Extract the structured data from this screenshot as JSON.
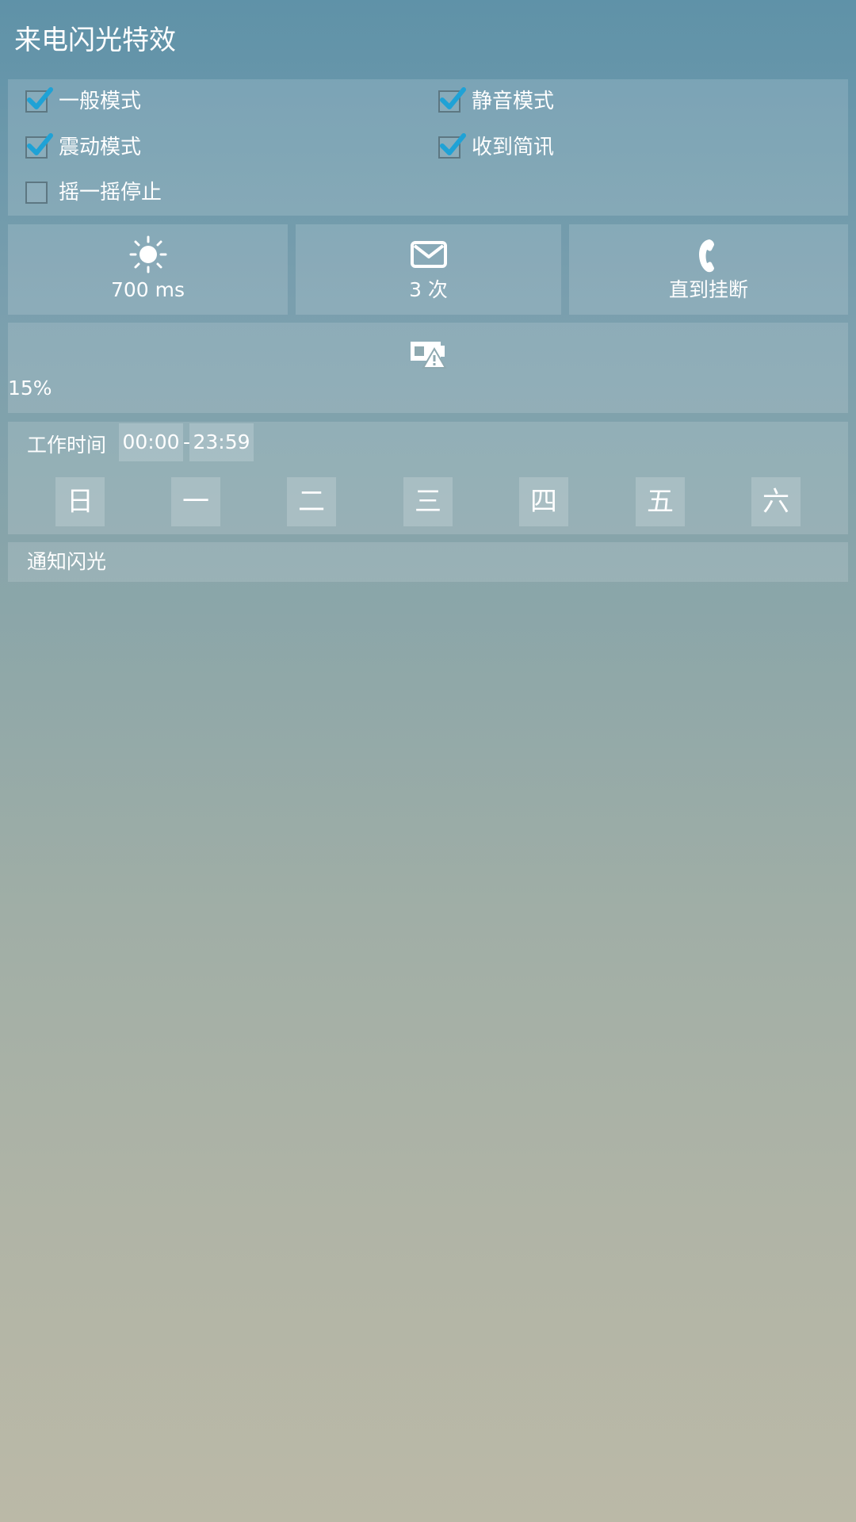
{
  "header": {
    "title": "来电闪光特效"
  },
  "options": [
    {
      "label": "一般模式",
      "checked": true
    },
    {
      "label": "静音模式",
      "checked": true
    },
    {
      "label": "震动模式",
      "checked": true
    },
    {
      "label": "收到简讯",
      "checked": true
    },
    {
      "label": "摇一摇停止",
      "checked": false
    }
  ],
  "stats": {
    "flash_duration": {
      "value": "700 ms",
      "icon": "sun-icon"
    },
    "sms_count": {
      "value": "3 次",
      "icon": "mail-icon"
    },
    "call_mode": {
      "value": "直到挂断",
      "icon": "phone-icon"
    },
    "battery": {
      "value": "15%",
      "icon": "battery-warning-icon"
    }
  },
  "schedule": {
    "label": "工作时间",
    "start": "00:00",
    "separator": "-",
    "end": "23:59",
    "days": [
      "日",
      "一",
      "二",
      "三",
      "四",
      "五",
      "六"
    ]
  },
  "notification": {
    "label": "通知闪光"
  },
  "colors": {
    "checkbox_border": "#5d7782",
    "checkmark": "#1fa2d6",
    "text": "#ffffff"
  }
}
